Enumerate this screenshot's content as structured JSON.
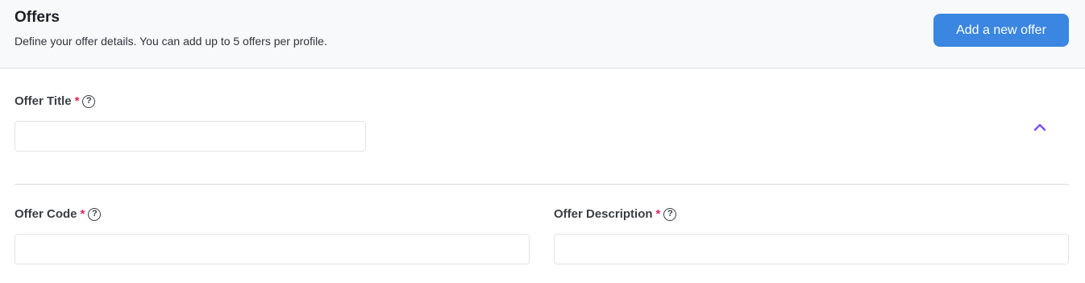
{
  "header": {
    "title": "Offers",
    "subtitle": "Define your offer details. You can add up to 5 offers per profile.",
    "add_button_label": "Add a new offer"
  },
  "fields": {
    "offer_title": {
      "label": "Offer Title",
      "required_mark": "*",
      "help_icon": "question-circle-icon",
      "value": ""
    },
    "offer_code": {
      "label": "Offer Code",
      "required_mark": "*",
      "help_icon": "question-circle-icon",
      "value": ""
    },
    "offer_description": {
      "label": "Offer Description",
      "required_mark": "*",
      "help_icon": "question-circle-icon",
      "value": ""
    }
  },
  "collapse_icon": "chevron-up-icon",
  "colors": {
    "accent_button": "#3a86e0",
    "required": "#e0245e",
    "chevron": "#7c4dff"
  }
}
